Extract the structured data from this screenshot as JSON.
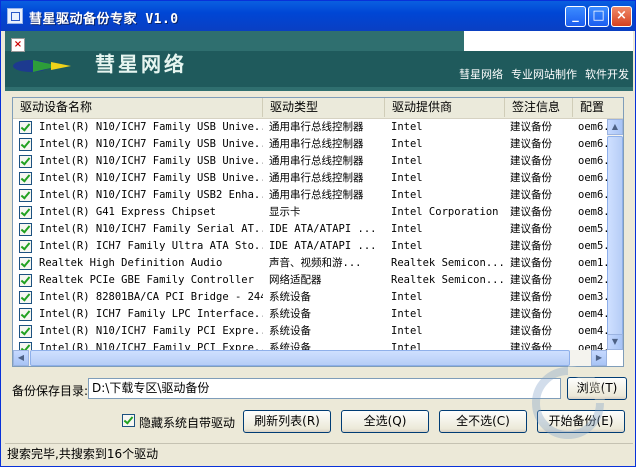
{
  "window": {
    "title": "彗星驱动备份专家 V1.0",
    "min_glyph": "_",
    "max_glyph": "□",
    "close_glyph": "×"
  },
  "banner": {
    "brand": "彗星网络",
    "close_glyph": "×",
    "links": [
      "彗星网络",
      "专业网站制作",
      "软件开发"
    ]
  },
  "table": {
    "columns": [
      "驱动设备名称",
      "驱动类型",
      "驱动提供商",
      "签注信息",
      "配置"
    ],
    "rows": [
      {
        "checked": true,
        "name": "Intel(R) N10/ICH7 Family USB Unive...",
        "type": "通用串行总线控制器",
        "provider": "Intel",
        "sign": "建议备份",
        "config": "oem6."
      },
      {
        "checked": true,
        "name": "Intel(R) N10/ICH7 Family USB Unive...",
        "type": "通用串行总线控制器",
        "provider": "Intel",
        "sign": "建议备份",
        "config": "oem6."
      },
      {
        "checked": true,
        "name": "Intel(R) N10/ICH7 Family USB Unive...",
        "type": "通用串行总线控制器",
        "provider": "Intel",
        "sign": "建议备份",
        "config": "oem6."
      },
      {
        "checked": true,
        "name": "Intel(R) N10/ICH7 Family USB Unive...",
        "type": "通用串行总线控制器",
        "provider": "Intel",
        "sign": "建议备份",
        "config": "oem6."
      },
      {
        "checked": true,
        "name": "Intel(R) N10/ICH7 Family USB2 Enha...",
        "type": "通用串行总线控制器",
        "provider": "Intel",
        "sign": "建议备份",
        "config": "oem6."
      },
      {
        "checked": true,
        "name": "Intel(R) G41 Express Chipset",
        "type": "显示卡",
        "provider": "Intel Corporation",
        "sign": "建议备份",
        "config": "oem8."
      },
      {
        "checked": true,
        "name": "Intel(R) N10/ICH7 Family Serial AT...",
        "type": "IDE ATA/ATAPI ...",
        "provider": "Intel",
        "sign": "建议备份",
        "config": "oem5."
      },
      {
        "checked": true,
        "name": "Intel(R) ICH7 Family Ultra ATA Sto...",
        "type": "IDE ATA/ATAPI ...",
        "provider": "Intel",
        "sign": "建议备份",
        "config": "oem5."
      },
      {
        "checked": true,
        "name": "Realtek High Definition Audio",
        "type": "声音、视频和游...",
        "provider": "Realtek Semicon...",
        "sign": "建议备份",
        "config": "oem1."
      },
      {
        "checked": true,
        "name": "Realtek PCIe GBE Family Controller",
        "type": "网络适配器",
        "provider": "Realtek Semicon...",
        "sign": "建议备份",
        "config": "oem2."
      },
      {
        "checked": true,
        "name": "Intel(R) 82801BA/CA PCI Bridge - 244E",
        "type": "系统设备",
        "provider": "Intel",
        "sign": "建议备份",
        "config": "oem3."
      },
      {
        "checked": true,
        "name": "Intel(R) ICH7 Family LPC Interface...",
        "type": "系统设备",
        "provider": "Intel",
        "sign": "建议备份",
        "config": "oem4."
      },
      {
        "checked": true,
        "name": "Intel(R) N10/ICH7 Family PCI Expre...",
        "type": "系统设备",
        "provider": "Intel",
        "sign": "建议备份",
        "config": "oem4."
      },
      {
        "checked": true,
        "name": "Intel(R) N10/ICH7 Family PCI Expre...",
        "type": "系统设备",
        "provider": "Intel",
        "sign": "建议备份",
        "config": "oem4."
      }
    ]
  },
  "backup": {
    "label": "备份保存目录:",
    "path": "D:\\下载专区\\驱动备份",
    "browse": "浏览(T)"
  },
  "controls": {
    "hide_system_label": "隐藏系统自带驱动",
    "hide_system_checked": true,
    "refresh": "刷新列表(R)",
    "select_all": "全选(Q)",
    "select_none": "全不选(C)",
    "start_backup": "开始备份(E)"
  },
  "status": {
    "text": "搜索完毕,共搜索到16个驱动"
  },
  "colors": {
    "titlebar": "#0a5fe0",
    "banner": "#1f5a5c",
    "check": "#21a121"
  },
  "icons": [
    "app-icon",
    "minimize-icon",
    "maximize-icon",
    "close-icon",
    "banner-close-icon",
    "scroll-up-icon",
    "scroll-down-icon",
    "scroll-left-icon",
    "scroll-right-icon"
  ]
}
